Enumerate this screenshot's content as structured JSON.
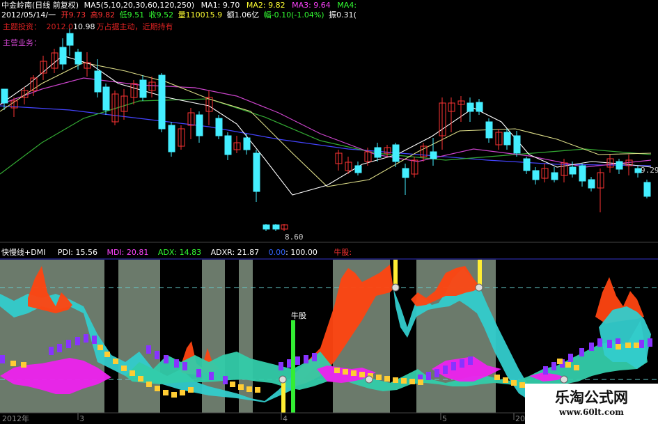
{
  "main_panel": {
    "stock_name": "中金岭南",
    "period": "(日线 前复权)",
    "ma_params": "MA5(5,10,20,30,60,120,250)",
    "ma_values": [
      {
        "label": "MA1: 9.70",
        "color": "#ffffff"
      },
      {
        "label": "MA2: 9.82",
        "color": "#ffff33"
      },
      {
        "label": "MA3: 9.64",
        "color": "#ff44ff"
      },
      {
        "label": "MA4:",
        "color": "#33ff33"
      }
    ],
    "date": "2012/05/14/一",
    "ohlc": {
      "open": "开9.73",
      "high": "高9.82",
      "low": "低9.51",
      "close": "收9.52",
      "volume": "量110015.9",
      "amount": "额1.06亿",
      "change": "幅-0.10(-1.04%)",
      "amplitude": "振0.31("
    },
    "theme_label": "主题投资：",
    "theme_value": "2012.0",
    "theme_price": "10.98",
    "theme_note": "万占据主动，近期持有",
    "business_label": "主营业务：",
    "price_right": "9.29",
    "price_low": "8.60",
    "colors": {
      "up": "#ff3333",
      "down": "#44eeff"
    }
  },
  "indicator_panel": {
    "name": "快慢线+DMI",
    "pdi": "PDI: 15.56",
    "mdi": "MDI: 20.81",
    "adx": "ADX: 14.83",
    "adxr": "ADXR: 21.87",
    "val1": "0.00",
    "val2": ": 100.00",
    "niugu": "牛股:",
    "signal_label": "牛股",
    "colors": {
      "pdi": "#ffffff",
      "mdi": "#ff44ff",
      "adx": "#33ff33",
      "adxr": "#ffffff",
      "val1": "#3366ff",
      "niugu": "#ff3333"
    }
  },
  "x_axis": {
    "labels": [
      "2012年",
      "3",
      "4",
      "5",
      "20"
    ]
  },
  "watermark": {
    "title": "乐淘公式网",
    "url": "www.60lt.com"
  }
}
